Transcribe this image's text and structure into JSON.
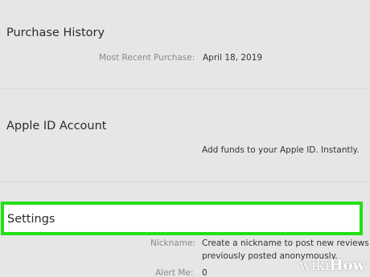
{
  "purchase_history": {
    "title": "Purchase History",
    "most_recent_label": "Most Recent Purchase:",
    "most_recent_value": "April 18, 2019"
  },
  "apple_id_account": {
    "title": "Apple ID Account",
    "add_funds_text": "Add funds to your Apple ID. Instantly."
  },
  "settings": {
    "title": "Settings",
    "nickname_label": "Nickname:",
    "nickname_line1": "Create a nickname to post new reviews or",
    "nickname_line2": "previously posted anonymously.",
    "alert_label": "Alert Me:",
    "alert_value": "0"
  },
  "watermark": {
    "wiki": "wiki",
    "how": "How"
  },
  "colors": {
    "background": "#e6e6e6",
    "highlight_border": "#22e017"
  }
}
